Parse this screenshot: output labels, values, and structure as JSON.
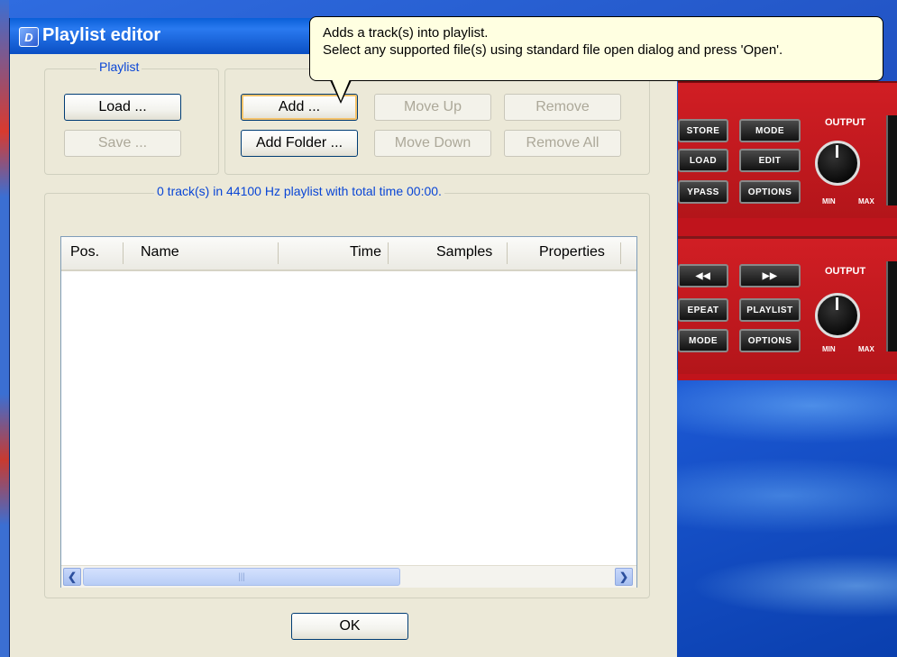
{
  "dialog": {
    "title": "Playlist editor",
    "playlist_group": {
      "legend": "Playlist",
      "load_label": "Load ...",
      "save_label": "Save ..."
    },
    "tracks_group": {
      "add_label": "Add ...",
      "add_folder_label": "Add Folder ...",
      "move_up_label": "Move Up",
      "move_down_label": "Move Down",
      "remove_label": "Remove",
      "remove_all_label": "Remove All"
    },
    "summary": "0 track(s) in 44100 Hz playlist with total time 00:00.",
    "list": {
      "columns": [
        "Pos.",
        "Name",
        "Time",
        "Samples",
        "Properties"
      ],
      "rows": []
    },
    "ok_label": "OK"
  },
  "tooltip": {
    "line1": "Adds a track(s) into playlist.",
    "line2": "Select any supported file(s) using standard file open dialog and press 'Open'."
  },
  "device": {
    "panel1": {
      "buttons": [
        "STORE",
        "MODE",
        "LOAD",
        "EDIT",
        "YPASS",
        "OPTIONS"
      ],
      "output_label": "OUTPUT",
      "min_label": "MIN",
      "max_label": "MAX"
    },
    "panel2": {
      "buttons": [
        "◀◀",
        "▶▶",
        "EPEAT",
        "PLAYLIST",
        "MODE",
        "OPTIONS"
      ],
      "output_label": "OUTPUT",
      "min_label": "MIN",
      "max_label": "MAX"
    }
  },
  "colors": {
    "titlebar": "#0a5fd8",
    "dialog_bg": "#ece9d8",
    "group_legend": "#0a46d6",
    "tooltip_bg": "#ffffe1",
    "device_red": "#c0141c"
  }
}
